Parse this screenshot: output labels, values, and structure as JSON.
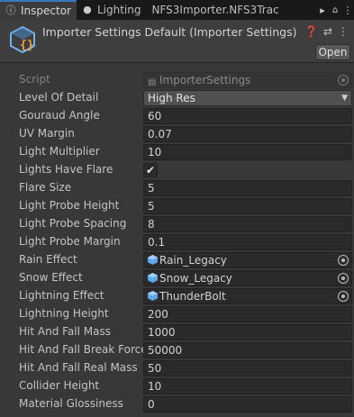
{
  "tabs": [
    {
      "label": "Inspector",
      "icon": "info-icon"
    },
    {
      "label": "Lighting",
      "icon": "lightbulb-icon"
    },
    {
      "label": "NFS3Importer.NFS3Trac",
      "icon": ""
    }
  ],
  "tab_controls": {
    "more": "▸",
    "lock": "🔒",
    "menu": "⋮"
  },
  "header": {
    "title": "Importer Settings Default (Importer Settings)",
    "open_label": "Open",
    "icons": [
      "help-icon",
      "preset-icon",
      "menu-icon"
    ]
  },
  "properties": [
    {
      "label": "Script",
      "type": "object-disabled",
      "value": "ImporterSettings"
    },
    {
      "label": "Level Of Detail",
      "type": "dropdown",
      "value": "High Res"
    },
    {
      "label": "Gouraud Angle",
      "type": "text",
      "value": "60"
    },
    {
      "label": "UV Margin",
      "type": "text",
      "value": "0.07"
    },
    {
      "label": "Light Multiplier",
      "type": "text",
      "value": "10"
    },
    {
      "label": "Lights Have Flare",
      "type": "checkbox",
      "value": "✔"
    },
    {
      "label": "Flare Size",
      "type": "text",
      "value": "5"
    },
    {
      "label": "Light Probe Height",
      "type": "text",
      "value": "5"
    },
    {
      "label": "Light Probe Spacing",
      "type": "text",
      "value": "8"
    },
    {
      "label": "Light Probe Margin",
      "type": "text",
      "value": "0.1"
    },
    {
      "label": "Rain Effect",
      "type": "object",
      "value": "Rain_Legacy"
    },
    {
      "label": "Snow Effect",
      "type": "object",
      "value": "Snow_Legacy"
    },
    {
      "label": "Lightning Effect",
      "type": "object",
      "value": "ThunderBolt"
    },
    {
      "label": "Lightning Height",
      "type": "text",
      "value": "200"
    },
    {
      "label": "Hit And Fall Mass",
      "type": "text",
      "value": "1000"
    },
    {
      "label": "Hit And Fall Break Force",
      "type": "text",
      "value": "50000"
    },
    {
      "label": "Hit And Fall Real Mass",
      "type": "text",
      "value": "50"
    },
    {
      "label": "Collider Height",
      "type": "text",
      "value": "10"
    },
    {
      "label": "Material Glossiness",
      "type": "text",
      "value": "0"
    }
  ],
  "colors": {
    "background": "#383838",
    "tab_accent": "#3a79bb",
    "prefab_icon": "#5ea7e8"
  }
}
